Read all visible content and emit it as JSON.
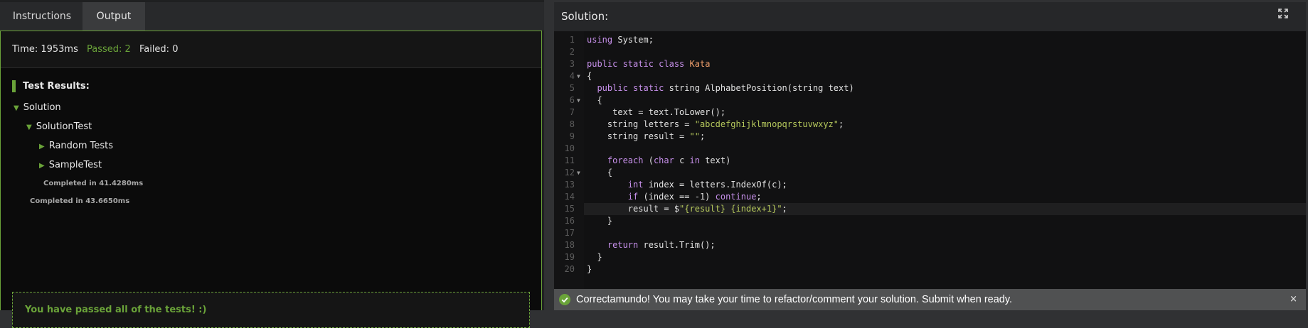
{
  "tabs": {
    "instructions": "Instructions",
    "output": "Output"
  },
  "stats": {
    "time": "Time: 1953ms",
    "passed": "Passed: 2",
    "failed": "Failed: 0"
  },
  "results": {
    "heading": "Test Results:",
    "tree": [
      {
        "label": "Solution",
        "expanded": true,
        "icon": "triangle-down-icon"
      },
      {
        "label": "SolutionTest",
        "expanded": true,
        "icon": "triangle-down-icon"
      },
      {
        "label": "Random Tests",
        "expanded": false,
        "icon": "triangle-right-icon"
      },
      {
        "label": "SampleTest",
        "expanded": false,
        "icon": "triangle-right-icon"
      }
    ],
    "completed_inner": "Completed in 41.4280ms",
    "completed_outer": "Completed in 43.6650ms",
    "pass_message": "You have passed all of the tests! :)"
  },
  "solution": {
    "title": "Solution:",
    "line_numbers": [
      "1",
      "2",
      "3",
      "4",
      "5",
      "6",
      "7",
      "8",
      "9",
      "10",
      "11",
      "12",
      "13",
      "14",
      "15",
      "16",
      "17",
      "18",
      "19",
      "20"
    ],
    "active_line": 15,
    "fold_lines": [
      4,
      6,
      12
    ],
    "code": {
      "l1_kw": "using",
      "l1_rest": " System;",
      "l3_kw": "public static class",
      "l3_cls": "Kata",
      "l4": "{",
      "l5_kw": "  public static",
      "l5_mid": " string AlphabetPosition(string text)",
      "l6": "  {",
      "l7": "     text = text.ToLower();",
      "l8_a": "    string letters = ",
      "l8_str": "\"abcdefghijklmnopqrstuvwxyz\"",
      "l8_b": ";",
      "l9_a": "    string result = ",
      "l9_str": "\"\"",
      "l9_b": ";",
      "l11_kw": "    foreach",
      "l11_a": " (",
      "l11_kw2": "char",
      "l11_b": " c ",
      "l11_kw3": "in",
      "l11_c": " text)",
      "l12": "    {",
      "l13_kw": "        int",
      "l13_rest": " index = letters.IndexOf(c);",
      "l14_kw": "        if",
      "l14_a": " (index == -1) ",
      "l14_kw2": "continue",
      "l14_b": ";",
      "l15_a": "        result = $",
      "l15_str": "\"{result} {index+1}\"",
      "l15_b": ";",
      "l16": "    }",
      "l18_kw": "    return",
      "l18_rest": " result.Trim();",
      "l19": "  }",
      "l20": "}"
    }
  },
  "notice": {
    "text": "Correctamundo! You may take your time to refactor/comment your solution. Submit when ready.",
    "close": "×"
  },
  "colors": {
    "accent_green": "#6aa339",
    "keyword": "#c891ec",
    "class_name": "#ec9d6a",
    "string": "#b6c95c"
  }
}
